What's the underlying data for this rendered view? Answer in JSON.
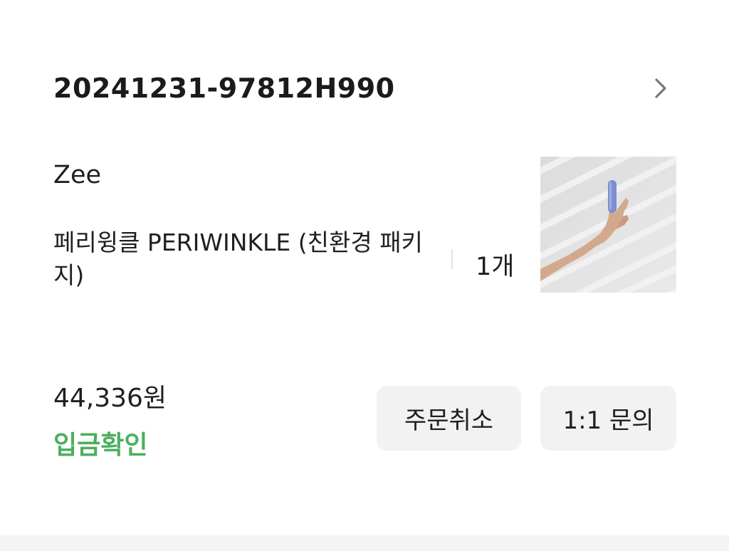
{
  "order": {
    "number": "20241231-97812H990"
  },
  "item": {
    "brand": "Zee",
    "name": "페리윙클 PERIWINKLE (친환경 패키지)",
    "quantity": "1개",
    "image_alt": "hand holding periwinkle vibrator"
  },
  "summary": {
    "price": "44,336원",
    "status": "입금확인"
  },
  "actions": {
    "cancel_label": "주문취소",
    "inquiry_label": "1:1 문의"
  },
  "colors": {
    "status": "#4caf5f",
    "button_bg": "#f2f2f2"
  },
  "icons": {
    "header_chevron": "chevron-right-icon"
  }
}
